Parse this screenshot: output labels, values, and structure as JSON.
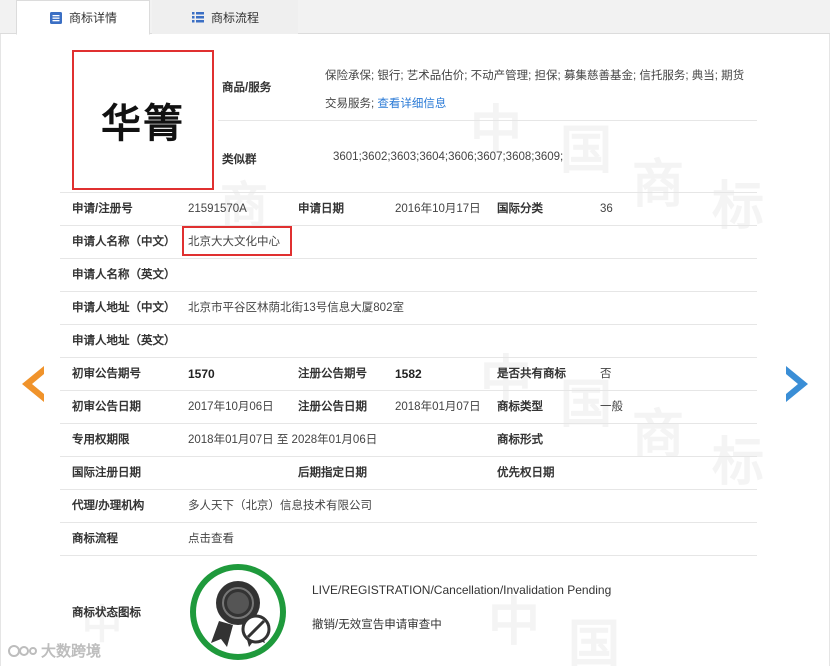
{
  "tabs": [
    {
      "label": "商标详情",
      "icon": "document-list-icon",
      "active": true
    },
    {
      "label": "商标流程",
      "icon": "list-icon",
      "active": false
    }
  ],
  "trademark": {
    "name": "华箐"
  },
  "goods": {
    "label": "商品/服务",
    "text": "保险承保; 银行; 艺术品估价; 不动产管理; 担保; 募集慈善基金; 信托服务; 典当; 期货交易服务;",
    "link": "查看详细信息"
  },
  "similar_group": {
    "label": "类似群",
    "value": "3601;3602;3603;3604;3606;3607;3608;3609;"
  },
  "rows": [
    {
      "cells": [
        {
          "label": "申请/注册号",
          "value": "21591570A"
        },
        {
          "label": "申请日期",
          "value": "2016年10月17日"
        },
        {
          "label": "国际分类",
          "value": "36"
        }
      ]
    },
    {
      "cells": [
        {
          "label": "申请人名称（中文）",
          "value": "北京大大文化中心"
        }
      ]
    },
    {
      "cells": [
        {
          "label": "申请人名称（英文）",
          "value": ""
        }
      ]
    },
    {
      "cells": [
        {
          "label": "申请人地址（中文）",
          "value": "北京市平谷区林荫北街13号信息大厦802室"
        }
      ]
    },
    {
      "cells": [
        {
          "label": "申请人地址（英文）",
          "value": ""
        }
      ]
    },
    {
      "cells": [
        {
          "label": "初审公告期号",
          "value": "1570"
        },
        {
          "label": "注册公告期号",
          "value": "1582"
        },
        {
          "label": "是否共有商标",
          "value": "否"
        }
      ]
    },
    {
      "cells": [
        {
          "label": "初审公告日期",
          "value": "2017年10月06日"
        },
        {
          "label": "注册公告日期",
          "value": "2018年01月07日"
        },
        {
          "label": "商标类型",
          "value": "一般"
        }
      ]
    },
    {
      "cells": [
        {
          "label": "专用权期限",
          "value": "2018年01月07日 至 2028年01月06日"
        },
        {
          "label": "商标形式",
          "value": ""
        }
      ]
    },
    {
      "cells": [
        {
          "label": "国际注册日期",
          "value": ""
        },
        {
          "label": "后期指定日期",
          "value": ""
        },
        {
          "label": "优先权日期",
          "value": ""
        }
      ]
    },
    {
      "cells": [
        {
          "label": "代理/办理机构",
          "value": "多人天下（北京）信息技术有限公司"
        }
      ]
    },
    {
      "cells": [
        {
          "label": "商标流程",
          "value": "点击查看"
        }
      ]
    }
  ],
  "status": {
    "label": "商标状态图标",
    "icon": "award-ribbon-cancel-icon",
    "en": "LIVE/REGISTRATION/Cancellation/Invalidation Pending",
    "zh": "撤销/无效宣告申请审查中"
  },
  "watermark_chars": [
    "中",
    "国",
    "商",
    "标"
  ],
  "footer_logo": "大数跨境",
  "colors": {
    "accent_red": "#e03030",
    "link_blue": "#2a7ad6",
    "arrow_orange": "#f0932b",
    "arrow_blue": "#3a8ed6",
    "status_green": "#1f9a3c"
  }
}
